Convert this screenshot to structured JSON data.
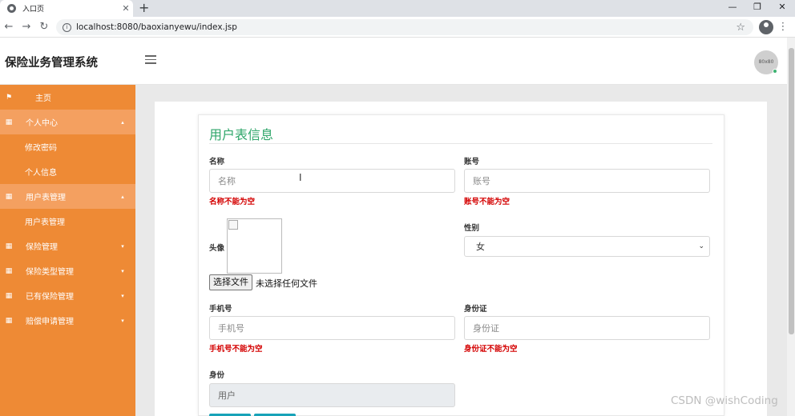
{
  "browser": {
    "tab_title": "入口页",
    "tab_close": "✕",
    "new_tab": "+",
    "win_min": "—",
    "win_restore": "❐",
    "win_close": "✕",
    "back": "←",
    "forward": "→",
    "reload": "↻",
    "info_glyph": "i",
    "url": "localhost:8080/baoxianyewu/index.jsp",
    "star": "☆",
    "menu": "⋮",
    "icons": [
      "globe-icon",
      "info-icon",
      "star-icon",
      "profile-icon",
      "menu-icon"
    ]
  },
  "header": {
    "brand": "保险业务管理系统",
    "avatar_text": "80x80"
  },
  "sidebar": {
    "items": [
      {
        "label": "主页",
        "icon": "⚑",
        "caret": ""
      },
      {
        "label": "个人中心",
        "icon": "▦",
        "caret": "▴"
      },
      {
        "label": "修改密码",
        "icon": "",
        "caret": ""
      },
      {
        "label": "个人信息",
        "icon": "",
        "caret": ""
      },
      {
        "label": "用户表管理",
        "icon": "▦",
        "caret": "▴"
      },
      {
        "label": "用户表管理",
        "icon": "",
        "caret": ""
      },
      {
        "label": "保险管理",
        "icon": "▦",
        "caret": "▾"
      },
      {
        "label": "保险类型管理",
        "icon": "▦",
        "caret": "▾"
      },
      {
        "label": "已有保险管理",
        "icon": "▦",
        "caret": "▾"
      },
      {
        "label": "赔偿申请管理",
        "icon": "▦",
        "caret": "▾"
      }
    ]
  },
  "form": {
    "title": "用户表信息",
    "name": {
      "label": "名称",
      "placeholder": "名称",
      "error": "名称不能为空"
    },
    "account": {
      "label": "账号",
      "placeholder": "账号",
      "error": "账号不能为空"
    },
    "avatar": {
      "label": "头像",
      "file_button": "选择文件",
      "file_status": "未选择任何文件"
    },
    "gender": {
      "label": "性别",
      "selected": "女",
      "chevron": "⌄"
    },
    "phone": {
      "label": "手机号",
      "placeholder": "手机号",
      "error": "手机号不能为空"
    },
    "idcard": {
      "label": "身份证",
      "placeholder": "身份证",
      "error": "身份证不能为空"
    },
    "role": {
      "label": "身份",
      "value": "用户"
    }
  },
  "overlay": {
    "cursor": "I",
    "watermark": "CSDN @wishCoding"
  },
  "colors": {
    "sidebar": "#ee8a35",
    "sidebar_active": "#f4a060",
    "title_green": "#2fa66a",
    "error_red": "#d40000"
  }
}
